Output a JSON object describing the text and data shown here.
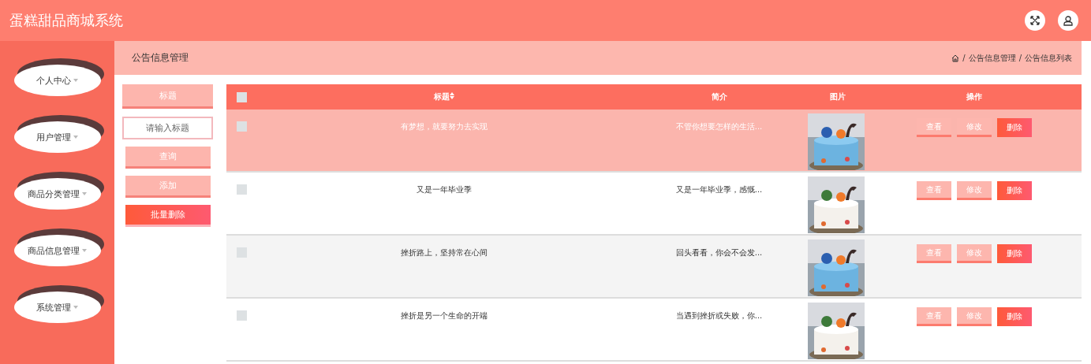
{
  "app_title": "蛋糕甜品商城系统",
  "sidebar": {
    "items": [
      {
        "label": "个人中心"
      },
      {
        "label": "用户管理"
      },
      {
        "label": "商品分类管理"
      },
      {
        "label": "商品信息管理"
      },
      {
        "label": "系统管理"
      }
    ]
  },
  "page_title": "公告信息管理",
  "breadcrumb": [
    {
      "separator": "/",
      "label": "公告信息管理"
    },
    {
      "separator": "/",
      "label": "公告信息列表"
    }
  ],
  "search": {
    "label": "标题",
    "placeholder": "请输入标题"
  },
  "actions": [
    {
      "label": "查询",
      "kind": "light"
    },
    {
      "label": "添加",
      "kind": "light"
    },
    {
      "label": "批量删除",
      "kind": "danger"
    }
  ],
  "table": {
    "columns": [
      "标题",
      "简介",
      "图片",
      "操作"
    ],
    "header_checked": false,
    "rows": [
      {
        "title": "有梦想，就要努力去实现",
        "summary": "不管你想要怎样的生活...",
        "highlighted": true,
        "checked": false,
        "buttons": [
          "查看",
          "修改",
          "删除"
        ]
      },
      {
        "title": "又是一年毕业季",
        "summary": "又是一年毕业季，感慨...",
        "highlighted": false,
        "checked": false,
        "buttons": [
          "查看",
          "修改",
          "删除"
        ]
      },
      {
        "title": "挫折路上，坚持常在心间",
        "summary": "回头看看，你会不会发...",
        "highlighted": false,
        "checked": false,
        "buttons": [
          "查看",
          "修改",
          "删除"
        ]
      },
      {
        "title": "挫折是另一个生命的开端",
        "summary": "当遇到挫折或失败，你...",
        "highlighted": false,
        "checked": false,
        "buttons": [
          "查看",
          "修改",
          "删除"
        ]
      }
    ]
  }
}
